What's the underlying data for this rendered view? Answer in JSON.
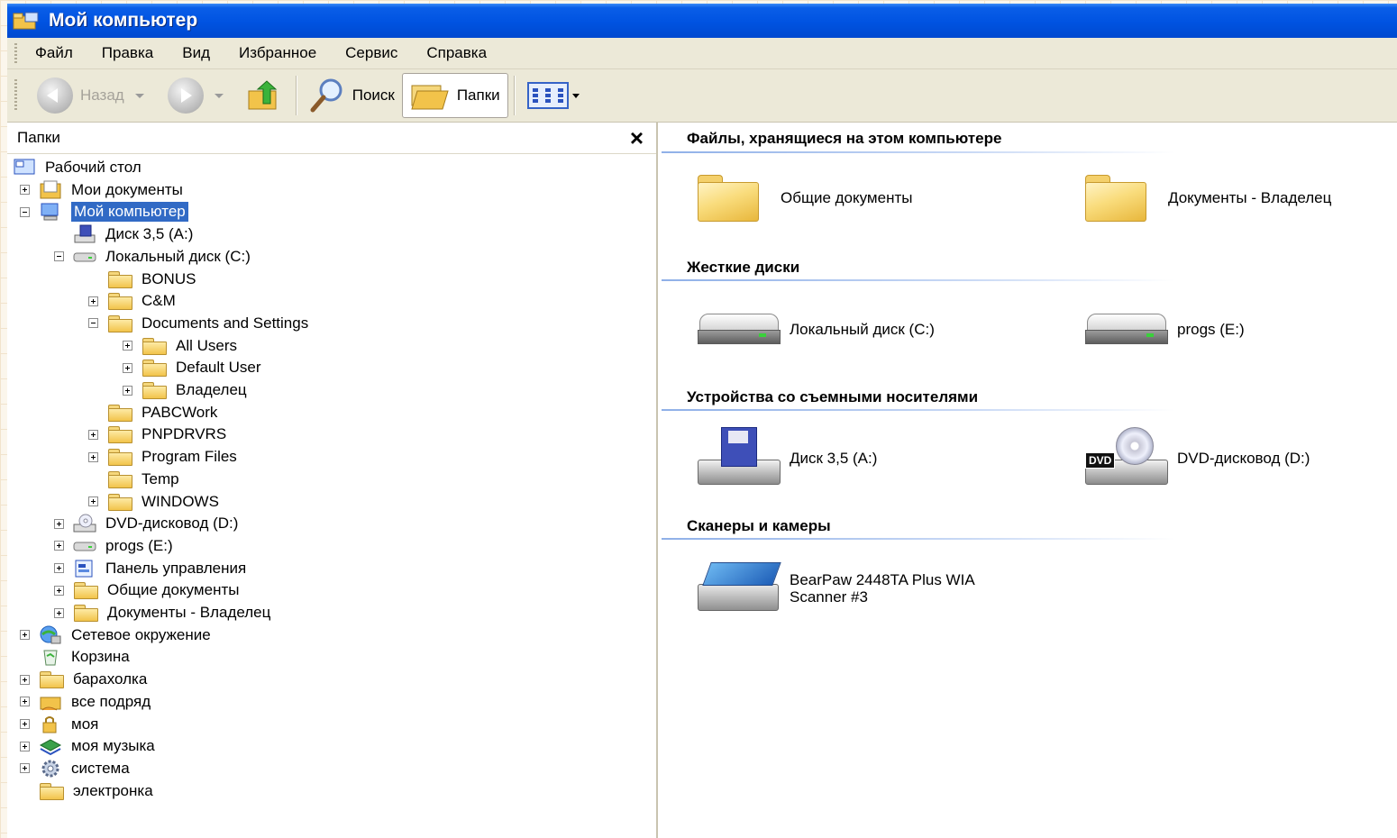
{
  "window": {
    "title": "Мой компьютер"
  },
  "menu": [
    "Файл",
    "Правка",
    "Вид",
    "Избранное",
    "Сервис",
    "Справка"
  ],
  "toolbar": {
    "back_label": "Назад",
    "search_label": "Поиск",
    "folders_label": "Папки"
  },
  "folders_pane": {
    "title": "Папки",
    "close_glyph": "×",
    "tree": [
      {
        "label": "Рабочий стол",
        "level": 0,
        "expander": "none",
        "icon": "desktop-icon"
      },
      {
        "label": "Мои документы",
        "level": 1,
        "expander": "plus",
        "icon": "my-documents-icon"
      },
      {
        "label": "Мой компьютер",
        "level": 1,
        "expander": "minus",
        "icon": "my-computer-icon",
        "selected": true
      },
      {
        "label": "Диск 3,5 (A:)",
        "level": 2,
        "expander": "none",
        "icon": "floppy-drive-icon"
      },
      {
        "label": "Локальный диск (C:)",
        "level": 2,
        "expander": "minus",
        "icon": "hard-drive-icon"
      },
      {
        "label": "BONUS",
        "level": 3,
        "expander": "none",
        "icon": "folder-icon"
      },
      {
        "label": "C&M",
        "level": 3,
        "expander": "plus",
        "icon": "folder-icon"
      },
      {
        "label": "Documents and Settings",
        "level": 3,
        "expander": "minus",
        "icon": "folder-icon"
      },
      {
        "label": "All Users",
        "level": 4,
        "expander": "plus",
        "icon": "folder-icon"
      },
      {
        "label": "Default User",
        "level": 4,
        "expander": "plus",
        "icon": "folder-icon"
      },
      {
        "label": "Владелец",
        "level": 4,
        "expander": "plus",
        "icon": "folder-icon"
      },
      {
        "label": "PABCWork",
        "level": 3,
        "expander": "none",
        "icon": "folder-icon"
      },
      {
        "label": "PNPDRVRS",
        "level": 3,
        "expander": "plus",
        "icon": "folder-icon"
      },
      {
        "label": "Program Files",
        "level": 3,
        "expander": "plus",
        "icon": "folder-icon"
      },
      {
        "label": "Temp",
        "level": 3,
        "expander": "none",
        "icon": "folder-icon"
      },
      {
        "label": "WINDOWS",
        "level": 3,
        "expander": "plus",
        "icon": "folder-icon"
      },
      {
        "label": "DVD-дисковод (D:)",
        "level": 2,
        "expander": "plus",
        "icon": "dvd-drive-icon"
      },
      {
        "label": "progs (E:)",
        "level": 2,
        "expander": "plus",
        "icon": "hard-drive-icon"
      },
      {
        "label": "Панель управления",
        "level": 2,
        "expander": "plus",
        "icon": "control-panel-icon"
      },
      {
        "label": "Общие документы",
        "level": 2,
        "expander": "plus",
        "icon": "folder-icon"
      },
      {
        "label": "Документы - Владелец",
        "level": 2,
        "expander": "plus",
        "icon": "folder-icon"
      },
      {
        "label": "Сетевое окружение",
        "level": 1,
        "expander": "plus",
        "icon": "network-icon"
      },
      {
        "label": "Корзина",
        "level": 1,
        "expander": "none",
        "icon": "recycle-bin-icon"
      },
      {
        "label": "барахолка",
        "level": 1,
        "expander": "plus",
        "icon": "folder-icon"
      },
      {
        "label": "все подряд",
        "level": 1,
        "expander": "plus",
        "icon": "shared-folder-icon"
      },
      {
        "label": "моя",
        "level": 1,
        "expander": "plus",
        "icon": "locked-folder-icon"
      },
      {
        "label": "моя музыка",
        "level": 1,
        "expander": "plus",
        "icon": "music-icon"
      },
      {
        "label": "система",
        "level": 1,
        "expander": "plus",
        "icon": "gear-icon"
      },
      {
        "label": "электронка",
        "level": 1,
        "expander": "none",
        "icon": "folder-icon"
      }
    ]
  },
  "content": {
    "sections": [
      {
        "title": "Файлы, хранящиеся на этом компьютере",
        "items": [
          "Общие документы",
          "Документы - Владелец"
        ]
      },
      {
        "title": "Жесткие диски",
        "items": [
          "Локальный диск (C:)",
          "progs (E:)"
        ]
      },
      {
        "title": "Устройства со съемными носителями",
        "items": [
          "Диск 3,5 (A:)",
          "DVD-дисковод (D:)"
        ]
      },
      {
        "title": "Сканеры и камеры",
        "items": [
          "BearPaw 2448TA Plus WIA Scanner #3"
        ]
      }
    ],
    "dvd_badge": "DVD"
  },
  "colors": {
    "titlebar": "#0053e1",
    "selection": "#316ac5",
    "chrome": "#ece9d8"
  }
}
